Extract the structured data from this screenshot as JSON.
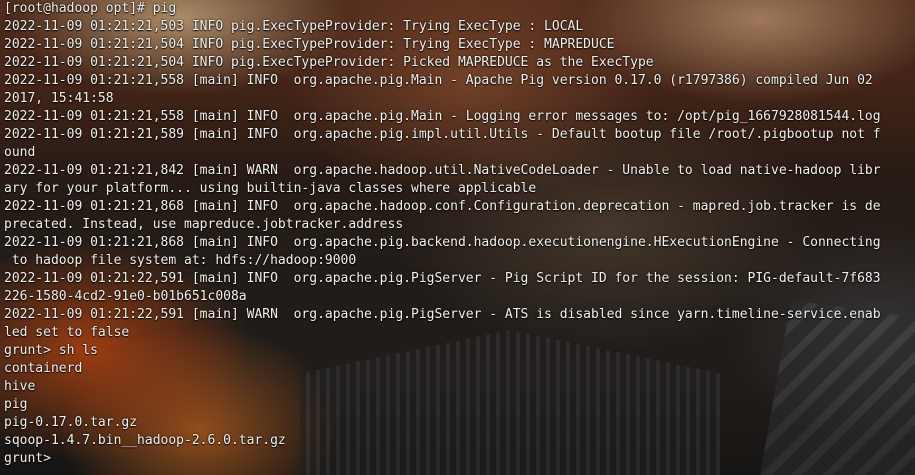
{
  "terminal": {
    "lines": [
      "[root@hadoop opt]# pig",
      "2022-11-09 01:21:21,503 INFO pig.ExecTypeProvider: Trying ExecType : LOCAL",
      "2022-11-09 01:21:21,504 INFO pig.ExecTypeProvider: Trying ExecType : MAPREDUCE",
      "2022-11-09 01:21:21,504 INFO pig.ExecTypeProvider: Picked MAPREDUCE as the ExecType",
      "2022-11-09 01:21:21,558 [main] INFO  org.apache.pig.Main - Apache Pig version 0.17.0 (r1797386) compiled Jun 02",
      "2017, 15:41:58",
      "2022-11-09 01:21:21,558 [main] INFO  org.apache.pig.Main - Logging error messages to: /opt/pig_1667928081544.log",
      "2022-11-09 01:21:21,589 [main] INFO  org.apache.pig.impl.util.Utils - Default bootup file /root/.pigbootup not f",
      "ound",
      "2022-11-09 01:21:21,842 [main] WARN  org.apache.hadoop.util.NativeCodeLoader - Unable to load native-hadoop libr",
      "ary for your platform... using builtin-java classes where applicable",
      "2022-11-09 01:21:21,868 [main] INFO  org.apache.hadoop.conf.Configuration.deprecation - mapred.job.tracker is de",
      "precated. Instead, use mapreduce.jobtracker.address",
      "2022-11-09 01:21:21,868 [main] INFO  org.apache.pig.backend.hadoop.executionengine.HExecutionEngine - Connecting",
      " to hadoop file system at: hdfs://hadoop:9000",
      "2022-11-09 01:21:22,591 [main] INFO  org.apache.pig.PigServer - Pig Script ID for the session: PIG-default-7f683",
      "226-1580-4cd2-91e0-b01b651c008a",
      "2022-11-09 01:21:22,591 [main] WARN  org.apache.pig.PigServer - ATS is disabled since yarn.timeline-service.enab",
      "led set to false",
      "grunt> sh ls",
      "containerd",
      "hive",
      "pig",
      "pig-0.17.0.tar.gz",
      "sqoop-1.4.7.bin__hadoop-2.6.0.tar.gz",
      "grunt> "
    ]
  },
  "colors": {
    "text": "#f3f1ee",
    "background_tint": "#080606"
  }
}
